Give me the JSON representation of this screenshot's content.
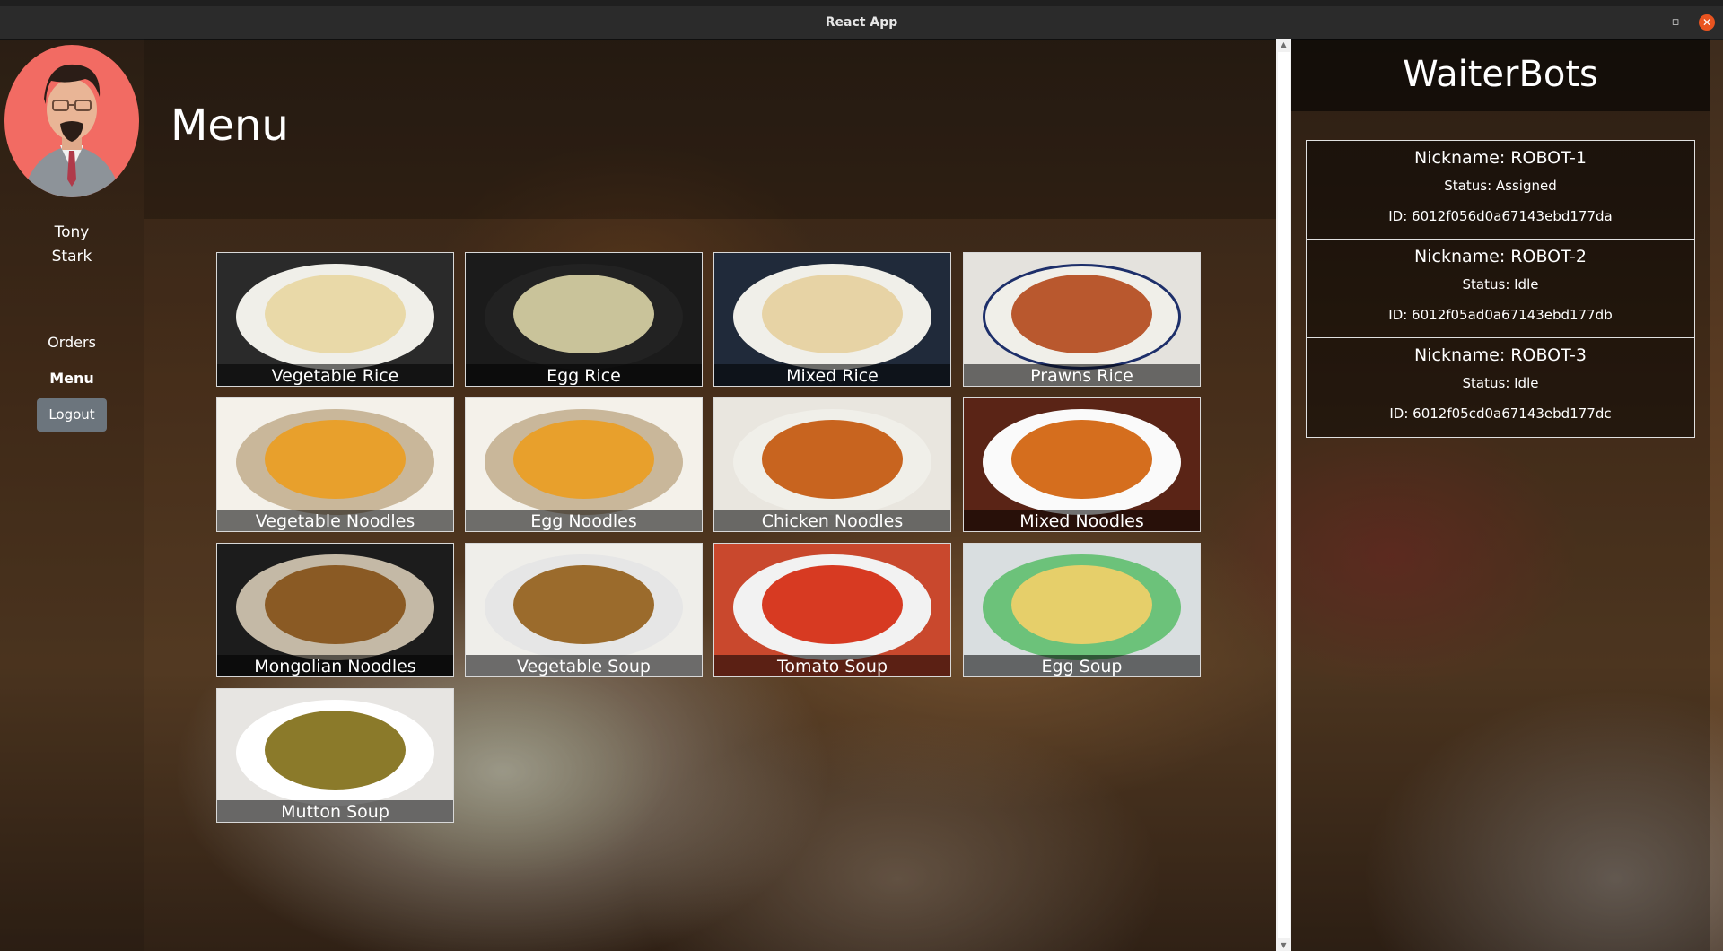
{
  "window": {
    "title": "React App",
    "controls": {
      "minimize": "–",
      "maximize": "▫",
      "close": "✕"
    }
  },
  "sidebar": {
    "user_first": "Tony",
    "user_last": "Stark",
    "nav": [
      {
        "label": "Orders",
        "active": false
      },
      {
        "label": "Menu",
        "active": true
      }
    ],
    "logout_label": "Logout"
  },
  "main": {
    "title": "Menu",
    "items": [
      {
        "name": "Vegetable Rice",
        "color": "#e9d9a8"
      },
      {
        "name": "Egg Rice",
        "color": "#c9c39a"
      },
      {
        "name": "Mixed Rice",
        "color": "#e7d3a5"
      },
      {
        "name": "Prawns Rice",
        "color": "#b9582e"
      },
      {
        "name": "Vegetable Noodles",
        "color": "#e8a02c"
      },
      {
        "name": "Egg Noodles",
        "color": "#e8a02c"
      },
      {
        "name": "Chicken Noodles",
        "color": "#c8641f"
      },
      {
        "name": "Mixed Noodles",
        "color": "#d56e1e"
      },
      {
        "name": "Mongolian Noodles",
        "color": "#8a5a24"
      },
      {
        "name": "Vegetable Soup",
        "color": "#9b6b2c"
      },
      {
        "name": "Tomato Soup",
        "color": "#d73a22"
      },
      {
        "name": "Egg Soup",
        "color": "#e6cf6a"
      },
      {
        "name": "Mutton Soup",
        "color": "#8b7a2a"
      }
    ]
  },
  "waiterbots": {
    "title": "WaiterBots",
    "robots": [
      {
        "nickname": "Nickname: ROBOT-1",
        "status": "Status: Assigned",
        "id": "ID: 6012f056d0a67143ebd177da"
      },
      {
        "nickname": "Nickname: ROBOT-2",
        "status": "Status: Idle",
        "id": "ID: 6012f05ad0a67143ebd177db"
      },
      {
        "nickname": "Nickname: ROBOT-3",
        "status": "Status: Idle",
        "id": "ID: 6012f05cd0a67143ebd177dc"
      }
    ]
  }
}
